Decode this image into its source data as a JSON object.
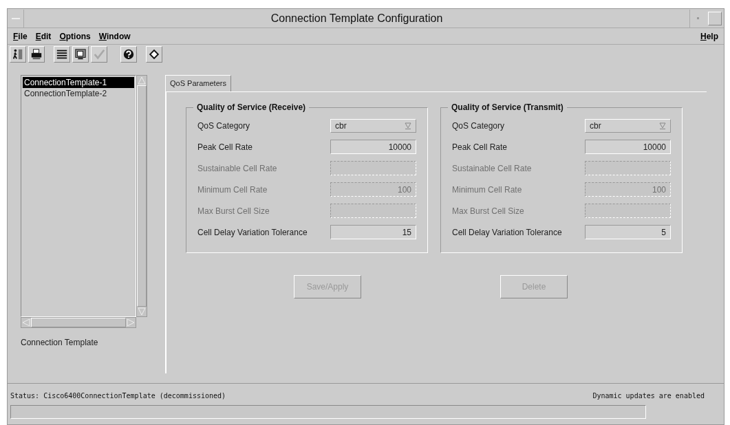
{
  "window": {
    "title": "Connection Template Configuration"
  },
  "menu": {
    "left": [
      {
        "label": "File"
      },
      {
        "label": "Edit"
      },
      {
        "label": "Options"
      },
      {
        "label": "Window"
      }
    ],
    "right": [
      {
        "label": "Help"
      }
    ]
  },
  "toolbar": [
    {
      "kind": "exit",
      "disabled": false
    },
    {
      "kind": "print",
      "disabled": false
    },
    {
      "kind": "list",
      "disabled": false
    },
    {
      "kind": "monitor",
      "disabled": false
    },
    {
      "kind": "check",
      "disabled": true
    },
    {
      "kind": "help",
      "disabled": false
    },
    {
      "kind": "diamond",
      "disabled": false
    }
  ],
  "templates": {
    "items": [
      {
        "label": "ConnectionTemplate-1",
        "selected": true
      },
      {
        "label": "ConnectionTemplate-2",
        "selected": false
      }
    ],
    "caption": "Connection Template"
  },
  "tabs": [
    {
      "label": "QoS Parameters",
      "selected": true
    }
  ],
  "groups": [
    {
      "title": "Quality of Service (Receive)",
      "rows": [
        {
          "label": "QoS Category",
          "kind": "dropdown",
          "value": "cbr",
          "disabled": false
        },
        {
          "label": "Peak Cell Rate",
          "kind": "text",
          "value": "10000",
          "disabled": false
        },
        {
          "label": "Sustainable Cell Rate",
          "kind": "text",
          "value": "",
          "disabled": true
        },
        {
          "label": "Minimum Cell Rate",
          "kind": "text",
          "value": "100",
          "disabled": true
        },
        {
          "label": "Max Burst Cell Size",
          "kind": "text",
          "value": "",
          "disabled": true
        },
        {
          "label": "Cell Delay Variation Tolerance",
          "kind": "text",
          "value": "15",
          "disabled": false
        }
      ]
    },
    {
      "title": "Quality of Service (Transmit)",
      "rows": [
        {
          "label": "QoS Category",
          "kind": "dropdown",
          "value": "cbr",
          "disabled": false
        },
        {
          "label": "Peak Cell Rate",
          "kind": "text",
          "value": "10000",
          "disabled": false
        },
        {
          "label": "Sustainable Cell Rate",
          "kind": "text",
          "value": "",
          "disabled": true
        },
        {
          "label": "Minimum Cell Rate",
          "kind": "text",
          "value": "100",
          "disabled": true
        },
        {
          "label": "Max Burst Cell Size",
          "kind": "text",
          "value": "",
          "disabled": true
        },
        {
          "label": "Cell Delay Variation Tolerance",
          "kind": "text",
          "value": "5",
          "disabled": false
        }
      ]
    }
  ],
  "buttons": [
    {
      "label": "Save/Apply",
      "disabled": true
    },
    {
      "label": "Delete",
      "disabled": true
    }
  ],
  "status_bar": {
    "text": "Status: Cisco6400ConnectionTemplate (decommissioned)",
    "right": "Dynamic updates are enabled"
  }
}
